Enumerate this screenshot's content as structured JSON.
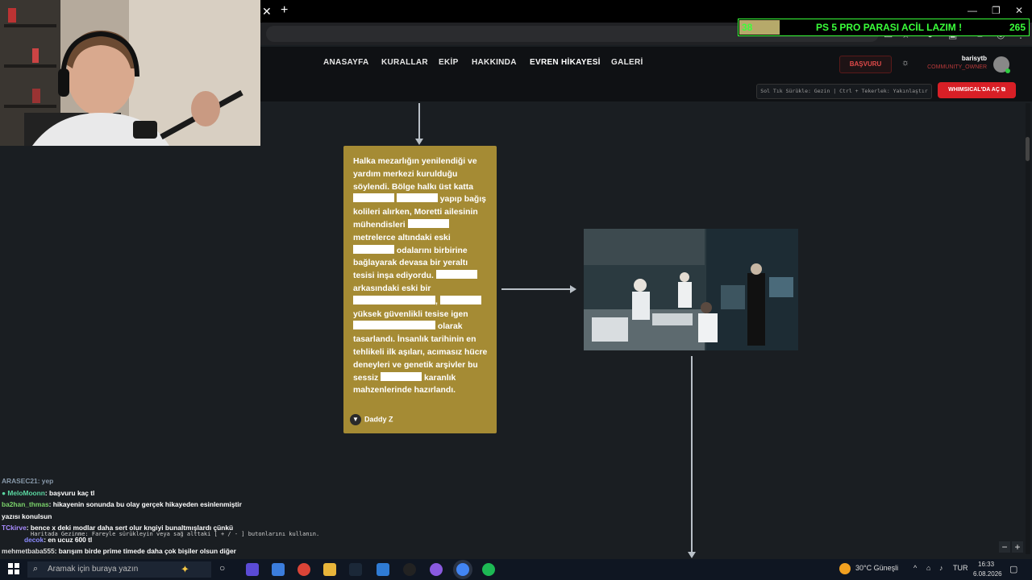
{
  "overlay": {
    "left_count": "38",
    "title": "PS 5 PRO PARASI ACİL LAZIM !",
    "right_count": "265",
    "progress": 0.14
  },
  "nav": {
    "items": [
      {
        "label": "ANASAYFA"
      },
      {
        "label": "KURALLAR"
      },
      {
        "label": "EKİP"
      },
      {
        "label": "HAKKINDA"
      },
      {
        "label": "EVREN HİKAYESİ"
      },
      {
        "label": "GALERİ"
      }
    ],
    "apply_label": "BAŞVURU",
    "username": "barisytb",
    "role": "COMMUNITY_OWNER"
  },
  "toolbar": {
    "hint": "Sol Tık Sürükle: Gezin | Ctrl + Tekerlek: Yakınlaştır",
    "whimsical_label": "WHIMSICAL'DA AÇ"
  },
  "story": {
    "segments": [
      "Halka mezarlığın yenilendiği ve yardım merkezi kurulduğu söylendi. Bölge halkı üst katta ",
      " yapıp bağış kolileri alırken, Moretti ailesinin mühendisleri ",
      " metrelerce altındaki eski ",
      " odalarını birbirine bağlayarak devasa bir yeraltı tesisi inşa ediyordu. ",
      " arkasındaki eski bir ",
      ", ",
      " yüksek güvenlikli tesise igen ",
      " olarak tasarlandı. İnsanlık tarihinin en tehlikeli ilk aşıları, acımasız hücre deneyleri ve genetik arşivler bu sessiz ",
      " karanlık mahzenlerinde hazırlandı."
    ],
    "author": "Daddy Z"
  },
  "map_hint": "Haritada Gezinme: Fareyle sürükleyin veya sağ alttaki [ + / - ] butonlarını kullanın.",
  "zoom": {
    "minus": "−",
    "plus": "+"
  },
  "chat": [
    {
      "user": "ARASEC21",
      "text": ": yep",
      "color": "#9aa"
    },
    {
      "user": "MeloMoonn",
      "text": ": başvuru kaç tl",
      "color": "#5ad6a0"
    },
    {
      "user": "ba2han_thmas",
      "text": ": hikayenin sonunda bu olay gerçek hikayeden esinlenmiştir yazısı konulsun",
      "color": "#7bd36b"
    },
    {
      "user": "TCkirve",
      "text": ": bence x deki modlar daha sert olur kngiyi bunaltmışlardı çünkü",
      "color": "#9a7bff"
    },
    {
      "user": "decok",
      "text": ": en ucuz 600 tl",
      "color": "#7b7bff"
    },
    {
      "user": "mehmetbaba555",
      "text": ": barışım birde prime timede daha çok bişiler olsun diğer sealerde daha zor olsunki farm için girmeyip rpde yapabilsinler",
      "color": "#d8d8d8"
    }
  ],
  "taskbar": {
    "search_placeholder": "Aramak için buraya yazın",
    "weather": "30°C  Güneşli",
    "lang": "TUR",
    "time": "16:33",
    "date": "6.08.2026"
  }
}
